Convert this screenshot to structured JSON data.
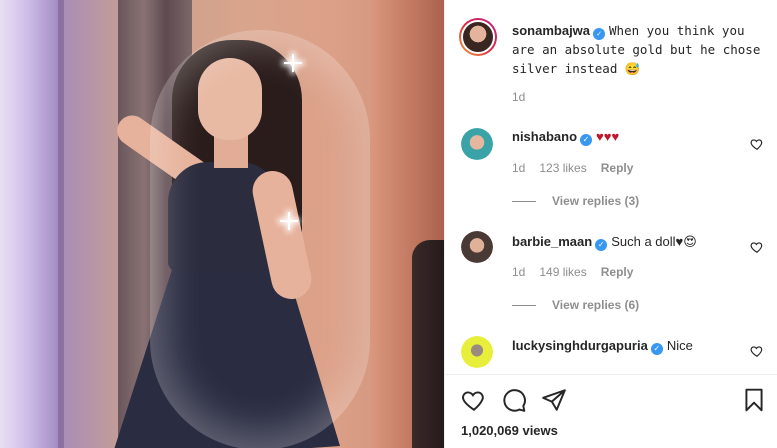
{
  "post": {
    "author": "sonambajwa",
    "caption": "When you think you are an absolute gold but he chose silver instead",
    "caption_emoji": "😅",
    "time": "1d",
    "views_count": "1,020,069",
    "views_label": "views"
  },
  "comments": [
    {
      "username": "nishabano",
      "verified": true,
      "text": "♥♥♥",
      "time": "1d",
      "likes": "123 likes",
      "reply_label": "Reply",
      "view_replies": "View replies (3)",
      "avatar_color": "#3aa3a8"
    },
    {
      "username": "barbie_maan",
      "verified": true,
      "text": "Such a doll♥😍",
      "time": "1d",
      "likes": "149 likes",
      "reply_label": "Reply",
      "view_replies": "View replies (6)",
      "avatar_color": "#4a3a36"
    },
    {
      "username": "luckysinghdurgapuria",
      "verified": true,
      "text": "Nice",
      "avatar_color": "#e8ef3a"
    }
  ],
  "icons": {
    "verified": "✓",
    "like": "heart-icon",
    "comment": "comment-icon",
    "share": "share-icon",
    "save": "bookmark-icon"
  },
  "colors": {
    "accent": "#3897f0",
    "heart_red": "#ed4956",
    "muted": "#8e8e8e"
  }
}
